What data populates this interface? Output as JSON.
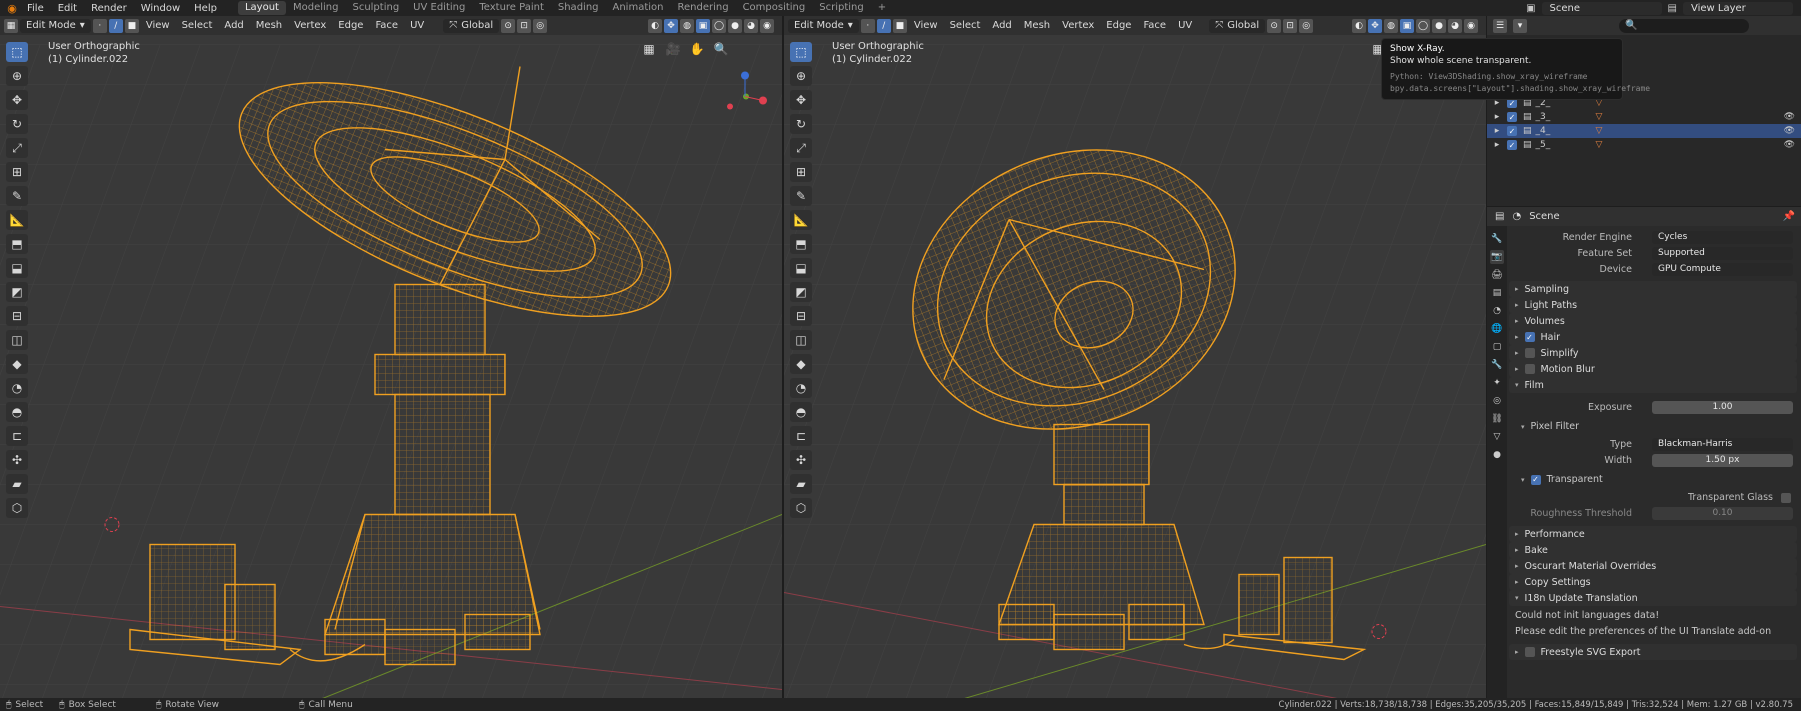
{
  "topbar": {
    "menus": [
      "File",
      "Edit",
      "Render",
      "Window",
      "Help"
    ],
    "workspaces": [
      "Layout",
      "Modeling",
      "Sculpting",
      "UV Editing",
      "Texture Paint",
      "Shading",
      "Animation",
      "Rendering",
      "Compositing",
      "Scripting"
    ],
    "add": "+",
    "scene": "Scene",
    "view_layer": "View Layer"
  },
  "viewport": {
    "mode": "Edit Mode",
    "menus": [
      "View",
      "Select",
      "Add",
      "Mesh",
      "Vertex",
      "Edge",
      "Face",
      "UV"
    ],
    "orientation": "Global",
    "view_name": "User Orthographic",
    "object_name": "(1) Cylinder.022"
  },
  "tooltip": {
    "title": "Show X-Ray.",
    "desc": "Show whole scene transparent.",
    "python1": "Python: View3DShading.show_xray_wireframe",
    "python2": "bpy.data.screens[\"Layout\"].shading.show_xray_wireframe"
  },
  "outliner": {
    "search_placeholder": "",
    "rows": [
      "_2_",
      "_3_",
      "_4_",
      "_5_"
    ],
    "selected_row": "_4_"
  },
  "properties": {
    "header": "Scene",
    "render_engine_label": "Render Engine",
    "render_engine": "Cycles",
    "feature_set_label": "Feature Set",
    "feature_set": "Supported",
    "device_label": "Device",
    "device": "GPU Compute",
    "panels_top": [
      "Sampling",
      "Light Paths",
      "Volumes",
      "Hair",
      "Simplify",
      "Motion Blur",
      "Film"
    ],
    "exposure_label": "Exposure",
    "exposure": "1.00",
    "pixel_filter": "Pixel Filter",
    "type_label": "Type",
    "type": "Blackman-Harris",
    "width_label": "Width",
    "width": "1.50 px",
    "transparent": "Transparent",
    "transparent_glass": "Transparent Glass",
    "roughness_label": "Roughness Threshold",
    "roughness": "0.10",
    "panels_bottom": [
      "Performance",
      "Bake",
      "Oscurart Material Overrides",
      "Copy Settings",
      "I18n Update Translation"
    ],
    "msg1": "Could not init languages data!",
    "msg2": "Please edit the preferences of the UI Translate add-on",
    "freestyle": "Freestyle SVG Export"
  },
  "status": {
    "select": "Select",
    "box_select": "Box Select",
    "rotate": "Rotate View",
    "call_menu": "Call Menu",
    "stats": "Cylinder.022 | Verts:18,738/18,738 | Edges:35,205/35,205 | Faces:15,849/15,849 | Tris:32,524 | Mem: 1.27 GB | v2.80.75"
  },
  "colors": {
    "wire": "#f0a020",
    "selection": "#4772b3",
    "viewport_bg": "#393939"
  }
}
